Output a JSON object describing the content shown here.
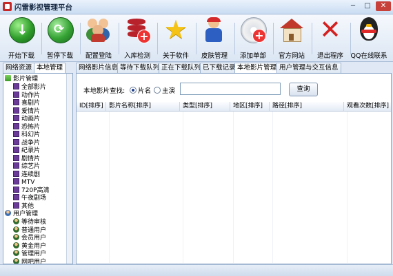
{
  "window": {
    "title": "闪雷影视管理平台",
    "min": "─",
    "max": "□",
    "close": "✕"
  },
  "toolbar": [
    {
      "label": "开始下载",
      "icon": "start-download-icon"
    },
    {
      "label": "暂停下载",
      "icon": "pause-download-icon"
    },
    {
      "label": "配置登陆",
      "icon": "config-login-icon"
    },
    {
      "label": "入库检测",
      "icon": "database-check-icon"
    },
    {
      "label": "关于软件",
      "icon": "star-icon"
    },
    {
      "label": "皮肤管理",
      "icon": "skin-icon"
    },
    {
      "label": "添加单部",
      "icon": "add-disc-icon"
    },
    {
      "label": "官方网站",
      "icon": "house-icon"
    },
    {
      "label": "退出程序",
      "icon": "exit-icon"
    },
    {
      "label": "QQ在线联系",
      "icon": "qq-penguin-icon"
    }
  ],
  "left_tabs": [
    "网络资源",
    "本地管理"
  ],
  "left_tabs_active": 1,
  "tree": {
    "group1": "影片管理",
    "movies": [
      "全部影片",
      "动作片",
      "喜剧片",
      "爱情片",
      "动画片",
      "恐怖片",
      "科幻片",
      "战争片",
      "纪录片",
      "剧情片",
      "综艺片",
      "连续剧",
      "MTV",
      "720P高清",
      "午夜剧场",
      "其他"
    ],
    "group2": "用户管理",
    "users": [
      "等待审核",
      "普通用户",
      "会员用户",
      "黄金用户",
      "管理用户",
      "网吧用户"
    ]
  },
  "right_tabs": [
    "网络影片信息",
    "等待下载队列",
    "正在下载队列",
    "已下载记录",
    "本地影片管理",
    "用户管理与交互信息"
  ],
  "right_tabs_active": 4,
  "search": {
    "label": "本地影片查找:",
    "option1": "片名",
    "option2": "主演",
    "selected": "片名",
    "value": "",
    "button": "查询"
  },
  "grid": {
    "columns": [
      "ID[排序]",
      "影片名称[排序]",
      "类型[排序]",
      "地区[排序]",
      "路径[排序]",
      "观看次数[排序]"
    ]
  },
  "colors": {
    "accent": "#1f3f8a",
    "panel_border": "#8fa8c8",
    "background": "#dfe8f4"
  }
}
